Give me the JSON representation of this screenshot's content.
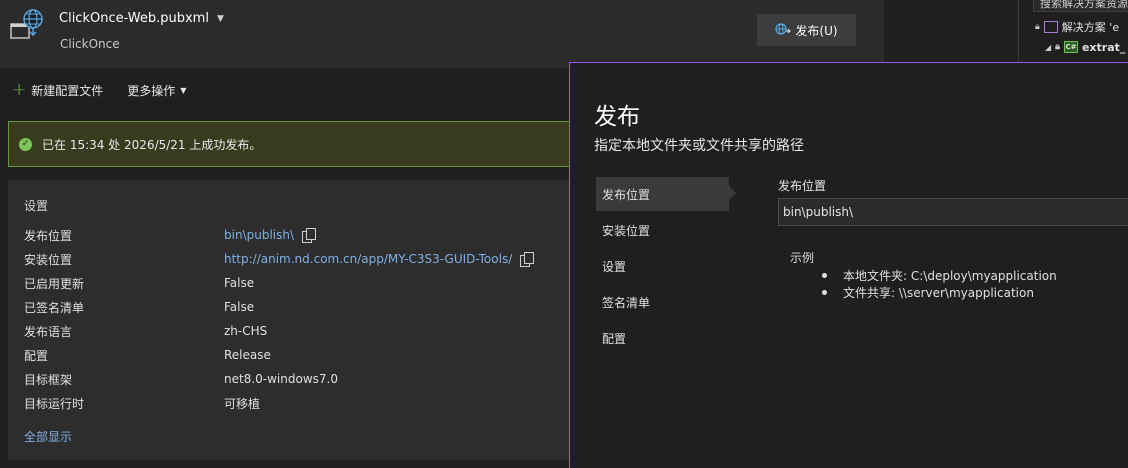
{
  "header": {
    "profile_name": "ClickOnce-Web.pubxml",
    "profile_type": "ClickOnce",
    "publish_button": "发布(U)"
  },
  "actions": {
    "new_profile": "新建配置文件",
    "more_actions": "更多操作"
  },
  "status": {
    "message": "已在 15:34 处 2026/5/21 上成功发布。"
  },
  "settings": {
    "title": "设置",
    "rows": [
      {
        "key": "发布位置",
        "value": "bin\\publish\\"
      },
      {
        "key": "安装位置",
        "value": "http://anim.nd.com.cn/app/MY-C3S3-GUID-Tools/"
      },
      {
        "key": "已启用更新",
        "value": "False"
      },
      {
        "key": "已签名清单",
        "value": "False"
      },
      {
        "key": "发布语言",
        "value": "zh-CHS"
      },
      {
        "key": "配置",
        "value": "Release"
      },
      {
        "key": "目标框架",
        "value": "net8.0-windows7.0"
      },
      {
        "key": "目标运行时",
        "value": "可移植"
      }
    ],
    "show_all": "全部显示"
  },
  "solution_explorer": {
    "search_placeholder": "搜索解决方案资源",
    "solution_label": "解决方案 'e",
    "project_label": "extrat_"
  },
  "dialog": {
    "title": "发布",
    "subtitle": "指定本地文件夹或文件共享的路径",
    "nav": [
      "发布位置",
      "安装位置",
      "设置",
      "签名清单",
      "配置"
    ],
    "field_label": "发布位置",
    "field_value": "bin\\publish\\",
    "examples_title": "示例",
    "examples": [
      "本地文件夹:  C:\\deploy\\myapplication",
      "文件共享: \\\\server\\myapplication"
    ]
  },
  "colors": {
    "accent_border": "#8b5cf6",
    "success_border": "#6a9a2e",
    "link": "#7fb0e5"
  },
  "icons": {
    "profile": "globe-publish-icon",
    "publish": "publish-icon",
    "new": "plus-icon",
    "success": "check-circle-icon",
    "copy": "copy-icon"
  }
}
